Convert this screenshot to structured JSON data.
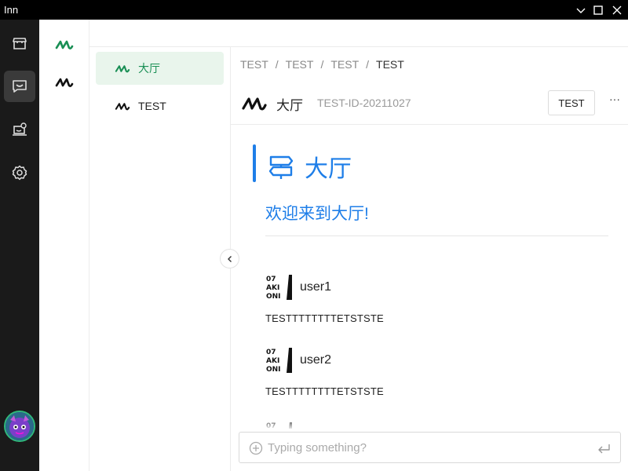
{
  "window": {
    "title": "Inn"
  },
  "colors": {
    "accent_green": "#1a8f55",
    "accent_blue": "#1e7ee8",
    "rail_bg": "#1a1a1a"
  },
  "rail": {
    "icons": [
      "store-icon",
      "chat-icon",
      "laptop-badge-icon",
      "gear-icon"
    ],
    "active": "chat-icon"
  },
  "channels": [
    {
      "label": "大厅",
      "active": true
    },
    {
      "label": "TEST",
      "active": false
    }
  ],
  "breadcrumb": [
    "TEST",
    "TEST",
    "TEST",
    "TEST"
  ],
  "header": {
    "channel_name": "大厅",
    "channel_id": "TEST-ID-20211027",
    "action_label": "TEST",
    "more_label": "···"
  },
  "welcome": {
    "title": "大厅",
    "subtitle": "欢迎来到大厅!"
  },
  "avatar_logo": {
    "line1": "07",
    "line2": "AKI",
    "line3": "ONI"
  },
  "messages": [
    {
      "user": "user1",
      "text": "TESTTTTTTTTETSTSTE"
    },
    {
      "user": "user2",
      "text": "TESTTTTTTTTETSTSTE"
    }
  ],
  "composer": {
    "placeholder": "Typing something?"
  }
}
